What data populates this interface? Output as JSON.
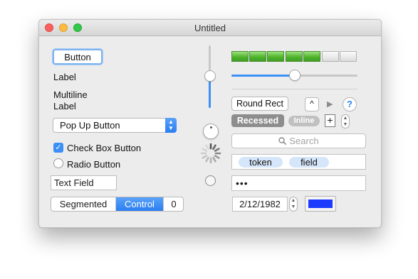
{
  "window": {
    "title": "Untitled"
  },
  "left_column": {
    "push_button_label": "Button",
    "label": "Label",
    "multiline_label": "Multiline\nLabel",
    "popup_button_label": "Pop Up Button",
    "checkbox_label": "Check Box Button",
    "checkbox_checked": true,
    "radio_label": "Radio Button",
    "text_field_value": "Text Field",
    "segmented": [
      "Segmented",
      "Control",
      "0"
    ],
    "segmented_selected": 1
  },
  "middle_column": {
    "vertical_slider_level": 0.52,
    "radio_selected": false
  },
  "right_column": {
    "level_indicator": {
      "segments": 7,
      "filled": 5
    },
    "horizontal_slider_level": 0.5,
    "round_rect_label": "Round Rect",
    "disclosure_glyph": "^",
    "triangle_glyph": "▶",
    "help_glyph": "?",
    "recessed_label": "Recessed",
    "inline_label": "Inline",
    "plus_glyph": "+",
    "search_placeholder": "Search",
    "tokens": [
      "token",
      "field"
    ],
    "secure_field_value": "•••",
    "date_value": "2/12/1982",
    "color_well": "#1c3bff"
  },
  "icons": {
    "search_icon": "magnifier",
    "stepper_icon": "up-down-chevrons",
    "checkmark_icon": "✓"
  },
  "colors": {
    "accent": "#3b8ff6",
    "level_green": "#4fb42e"
  }
}
